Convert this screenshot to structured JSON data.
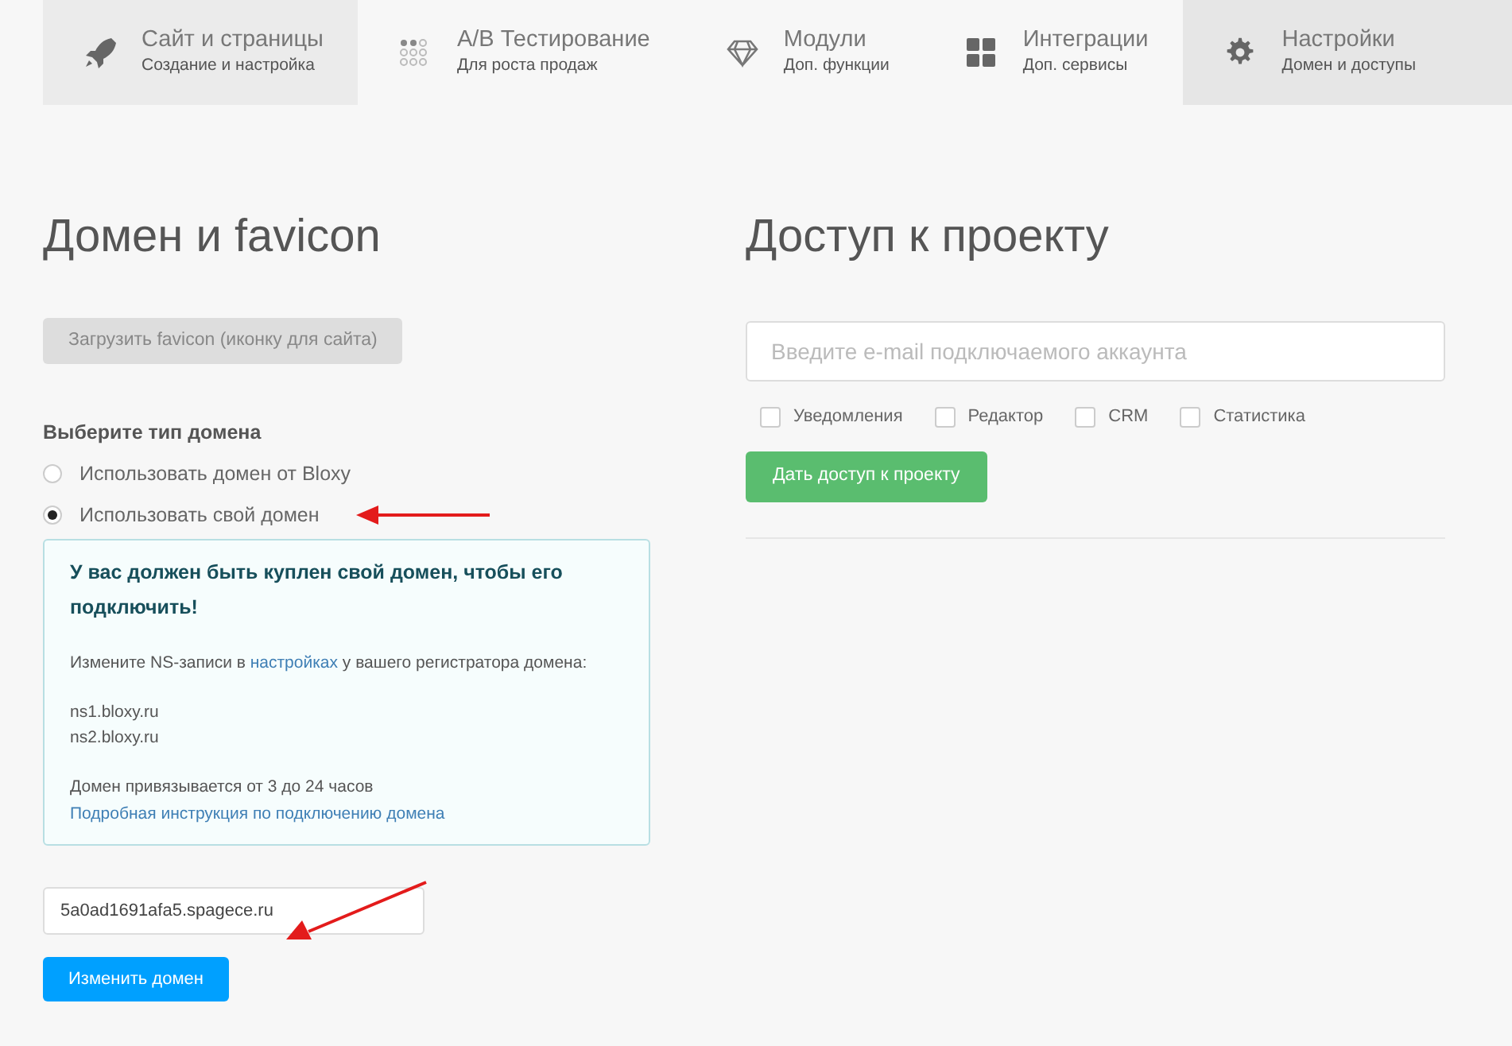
{
  "tabs": [
    {
      "title": "Сайт и страницы",
      "subtitle": "Создание и настройка",
      "kind": "rocket",
      "selected": false,
      "hovered": true
    },
    {
      "title": "A/B Тестирование",
      "subtitle": "Для роста продаж",
      "kind": "dots",
      "selected": false,
      "hovered": false
    },
    {
      "title": "Модули",
      "subtitle": "Доп. функции",
      "kind": "diamond",
      "selected": false,
      "hovered": false
    },
    {
      "title": "Интеграции",
      "subtitle": "Доп. сервисы",
      "kind": "grid",
      "selected": false,
      "hovered": false
    },
    {
      "title": "Настройки",
      "subtitle": "Домен и доступы",
      "kind": "gear",
      "selected": true,
      "hovered": false
    }
  ],
  "domain": {
    "heading": "Домен и favicon",
    "upload_button": "Загрузить favicon (иконку для сайта)",
    "type_label": "Выберите тип домена",
    "options": [
      {
        "label": "Использовать домен от Bloxy",
        "selected": false
      },
      {
        "label": "Использовать свой домен",
        "selected": true
      }
    ],
    "notice": {
      "title": "У вас должен быть куплен свой домен, чтобы его подключить!",
      "text_before": "Измените NS-записи в ",
      "link": "настройках",
      "text_after": " у вашего регистратора домена:",
      "servers": [
        "ns1.bloxy.ru",
        "ns2.bloxy.ru"
      ],
      "timing": "Домен привязывается от 3 до 24 часов",
      "guide_link": "Подробная инструкция по подключению домена"
    },
    "domain_value": "5a0ad1691afa5.spagece.ru",
    "change_button": "Изменить домен"
  },
  "access": {
    "heading": "Доступ к проекту",
    "email_placeholder": "Введите e-mail подключаемого аккаунта",
    "permissions": [
      {
        "label": "Уведомления",
        "checked": false
      },
      {
        "label": "Редактор",
        "checked": false
      },
      {
        "label": "CRM",
        "checked": false
      },
      {
        "label": "Статистика",
        "checked": false
      }
    ],
    "grant_button": "Дать доступ к проекту"
  }
}
